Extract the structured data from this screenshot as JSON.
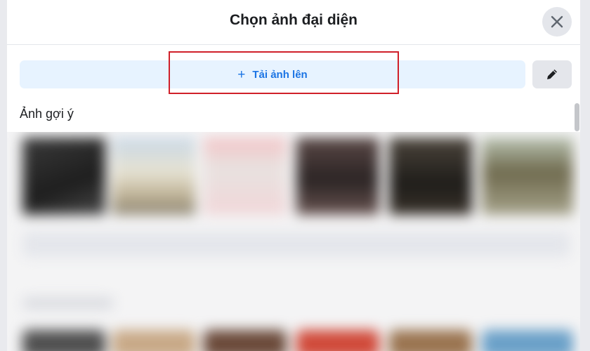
{
  "dialog": {
    "title": "Chọn ảnh đại diện",
    "close_icon": "close-icon",
    "upload_label": "Tải ảnh lên",
    "upload_icon": "plus-icon",
    "edit_icon": "pencil-icon",
    "suggested_title": "Ảnh gợi ý"
  },
  "colors": {
    "accent": "#1b74e4",
    "upload_bg": "#e7f3ff",
    "highlight_border": "#d0202a"
  }
}
